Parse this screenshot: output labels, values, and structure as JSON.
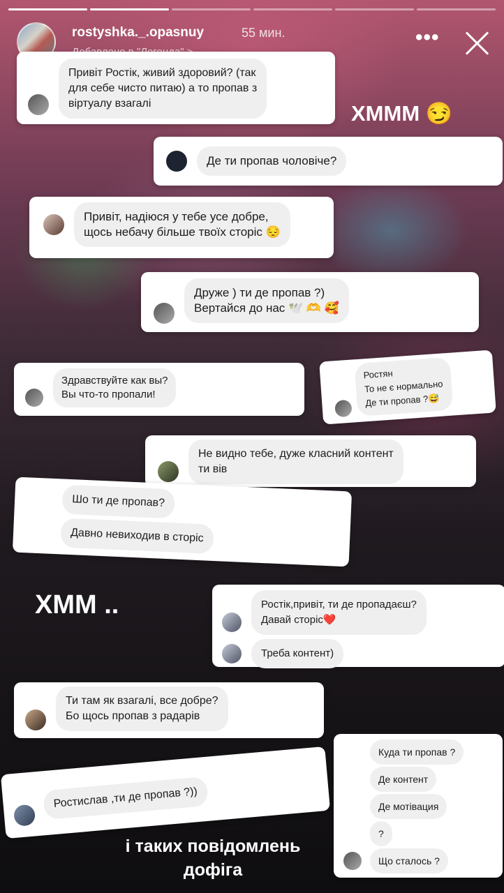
{
  "header": {
    "username": "rostyshka._.opasnuy",
    "time": "55 мин.",
    "added_to": "Добавлено в \"Легенда\" >",
    "more_icon": "•••",
    "progress_segments": 6,
    "progress_done": 1
  },
  "overlay": {
    "hmmm_1": "ХМММ 😏",
    "hmmm_2": "ХММ ..",
    "footer": "і таких повідомлень\nдофіга"
  },
  "messages": [
    {
      "text": "Привіт Ростік, живий здоровий? (так\nдля себе чисто питаю) а то пропав з\nвіртуалу взагалі"
    },
    {
      "text": "Де ти пропав чоловіче?"
    },
    {
      "text": "Привіт, надіюся у тебе усе добре,\nщось небачу більше твоїх сторіс 😔"
    },
    {
      "text": "Друже ) ти де пропав ?)\nВертайся до нас 🕊️ 🫶 🥰"
    },
    {
      "text": "Здравствуйте как вы?\nВы что-то пропали!"
    },
    {
      "text": "Ростян\nТо не є нормально\nДе ти пропав ?😅"
    },
    {
      "text": "Не видно тебе, дуже класний контент\nти вів"
    },
    {
      "text": "Шо ти де пропав?"
    },
    {
      "text": "Давно невиходив в сторіс"
    },
    {
      "text": "Ростік,привіт, ти де пропадаєш?\nДавай сторіс❤️"
    },
    {
      "text": "Треба контент)"
    },
    {
      "text": "Ти там як взагалі, все добре?\nБо щось пропав з радарів"
    },
    {
      "text": "Ростислав ,ти де пропав ?))"
    },
    {
      "text": "Куда ти пропав ?"
    },
    {
      "text": "Де контент"
    },
    {
      "text": "Де мотівация"
    },
    {
      "text": "?"
    },
    {
      "text": "Що сталось ?"
    }
  ]
}
